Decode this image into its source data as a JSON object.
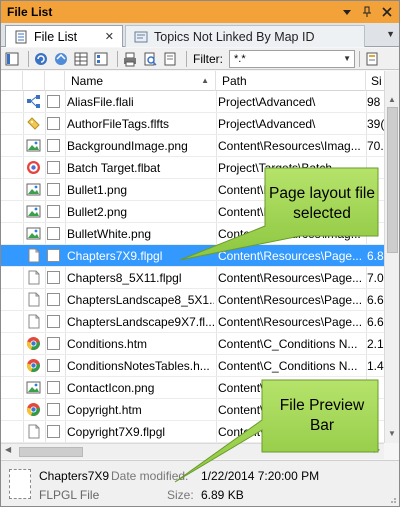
{
  "window": {
    "title": "File List"
  },
  "tabs": [
    {
      "label": "File List",
      "active": true
    },
    {
      "label": "Topics Not Linked By Map ID",
      "active": false
    }
  ],
  "toolbar": {
    "filter_label": "Filter:",
    "filter_value": "*.*"
  },
  "columns": {
    "name": "Name",
    "path": "Path",
    "size": "Si"
  },
  "rows": [
    {
      "icon": "alias-icon",
      "name": "AliasFile.flali",
      "path": "Project\\Advanced\\",
      "size": "98"
    },
    {
      "icon": "tag-icon",
      "name": "AuthorFileTags.flfts",
      "path": "Project\\Advanced\\",
      "size": "39("
    },
    {
      "icon": "image-icon",
      "name": "BackgroundImage.png",
      "path": "Content\\Resources\\Imag...",
      "size": "70."
    },
    {
      "icon": "target-icon",
      "name": "Batch Target.flbat",
      "path": "Project\\Targets\\Batch...",
      "size": ""
    },
    {
      "icon": "image-icon",
      "name": "Bullet1.png",
      "path": "Content\\Resources\\Imag...",
      "size": ""
    },
    {
      "icon": "image-icon",
      "name": "Bullet2.png",
      "path": "Content\\Resources\\Imag...",
      "size": ""
    },
    {
      "icon": "image-icon",
      "name": "BulletWhite.png",
      "path": "Content\\Resources\\Imag...",
      "size": ""
    },
    {
      "icon": "page-layout-icon",
      "name": "Chapters7X9.flpgl",
      "path": "Content\\Resources\\Page...",
      "size": "6.8"
    },
    {
      "icon": "page-layout-icon",
      "name": "Chapters8_5X11.flpgl",
      "path": "Content\\Resources\\Page...",
      "size": "7.0"
    },
    {
      "icon": "page-layout-icon",
      "name": "ChaptersLandscape8_5X1...",
      "path": "Content\\Resources\\Page...",
      "size": "6.6"
    },
    {
      "icon": "page-layout-icon",
      "name": "ChaptersLandscape9X7.fl...",
      "path": "Content\\Resources\\Page...",
      "size": "6.6"
    },
    {
      "icon": "chrome-icon",
      "name": "Conditions.htm",
      "path": "Content\\C_Conditions N...",
      "size": "2.1"
    },
    {
      "icon": "chrome-icon",
      "name": "ConditionsNotesTables.h...",
      "path": "Content\\C_Conditions N...",
      "size": "1.4"
    },
    {
      "icon": "image-icon",
      "name": "ContactIcon.png",
      "path": "Content\\Resources\\Imag...",
      "size": ""
    },
    {
      "icon": "chrome-icon",
      "name": "Copyright.htm",
      "path": "Content\\C_Conditions N...",
      "size": ""
    },
    {
      "icon": "page-layout-icon",
      "name": "Copyright7X9.flpgl",
      "path": "Content\\Resources\\Page...",
      "size": ""
    }
  ],
  "selected_index": 7,
  "preview": {
    "name": "Chapters7X9",
    "type": "FLPGL File",
    "date_modified_label": "Date modified:",
    "date_modified": "1/22/2014 7:20:00 PM",
    "size_label": "Size:",
    "size": "6.89 KB"
  },
  "callouts": {
    "page_layout": [
      "Page layout file",
      "selected"
    ],
    "preview_bar": [
      "File Preview",
      "Bar"
    ]
  },
  "colors": {
    "title_bar": "#f3a23a",
    "selection": "#3399ff",
    "callout_fill": "#9bd14a"
  }
}
